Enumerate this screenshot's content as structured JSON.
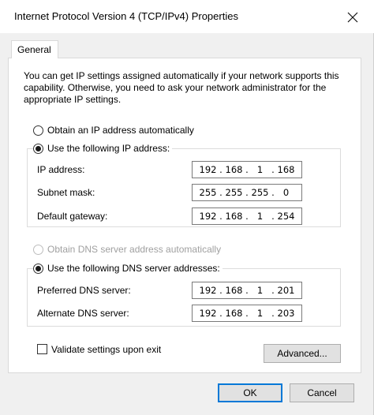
{
  "window": {
    "title": "Internet Protocol Version 4 (TCP/IPv4) Properties"
  },
  "tabs": [
    {
      "label": "General"
    }
  ],
  "description": "You can get IP settings assigned automatically if your network supports this capability. Otherwise, you need to ask your network administrator for the appropriate IP settings.",
  "ip_section": {
    "auto_label": "Obtain an IP address automatically",
    "manual_label": "Use the following IP address:",
    "selected": "manual",
    "fields": [
      {
        "label": "IP address:",
        "octets": [
          "192",
          "168",
          "1",
          "168"
        ]
      },
      {
        "label": "Subnet mask:",
        "octets": [
          "255",
          "255",
          "255",
          "0"
        ]
      },
      {
        "label": "Default gateway:",
        "octets": [
          "192",
          "168",
          "1",
          "254"
        ]
      }
    ]
  },
  "dns_section": {
    "auto_label": "Obtain DNS server address automatically",
    "manual_label": "Use the following DNS server addresses:",
    "selected": "manual",
    "fields": [
      {
        "label": "Preferred DNS server:",
        "octets": [
          "192",
          "168",
          "1",
          "201"
        ]
      },
      {
        "label": "Alternate DNS server:",
        "octets": [
          "192",
          "168",
          "1",
          "203"
        ]
      }
    ]
  },
  "validate": {
    "label": "Validate settings upon exit",
    "checked": false
  },
  "buttons": {
    "advanced": "Advanced...",
    "ok": "OK",
    "cancel": "Cancel"
  },
  "icons": {
    "close": "close-icon"
  }
}
